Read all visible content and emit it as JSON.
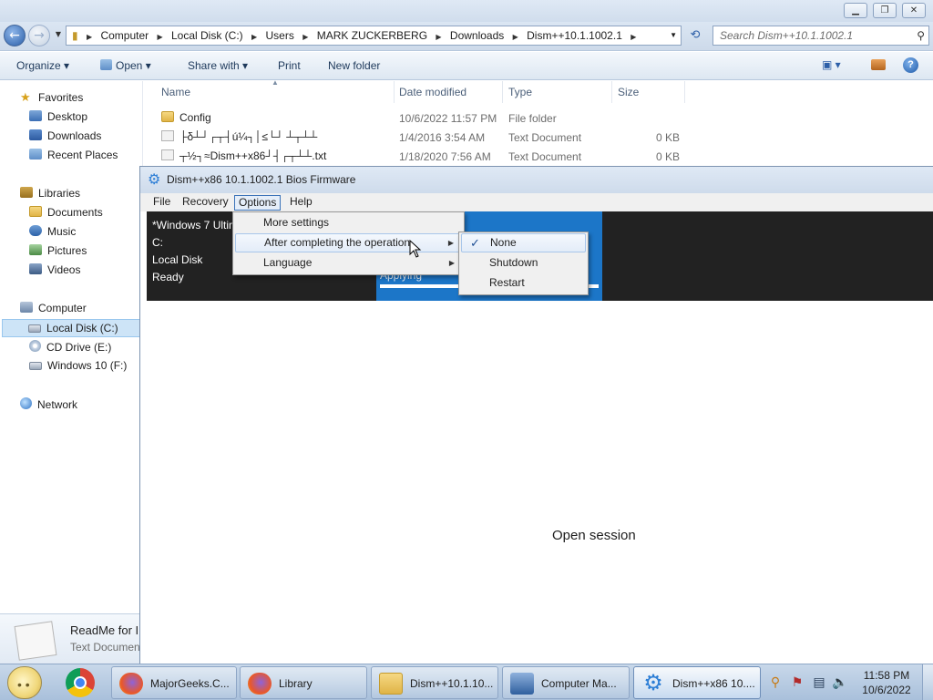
{
  "explorer": {
    "breadcrumbs": [
      "Computer",
      "Local Disk (C:)",
      "Users",
      "MARK ZUCKERBERG",
      "Downloads",
      "Dism++10.1.1002.1"
    ],
    "search_placeholder": "Search Dism++10.1.1002.1",
    "toolbar": {
      "organize": "Organize ▾",
      "open": "Open ▾",
      "share_with": "Share with ▾",
      "print": "Print",
      "new_folder": "New folder"
    },
    "nav": {
      "favorites": "Favorites",
      "desktop": "Desktop",
      "downloads": "Downloads",
      "recent_places": "Recent Places",
      "libraries": "Libraries",
      "documents": "Documents",
      "music": "Music",
      "pictures": "Pictures",
      "videos": "Videos",
      "computer": "Computer",
      "local_disk": "Local Disk (C:)",
      "cd_drive": "CD Drive (E:)",
      "windows10": "Windows 10 (F:)",
      "network": "Network"
    },
    "columns": {
      "name": "Name",
      "date": "Date modified",
      "type": "Type",
      "size": "Size"
    },
    "files": [
      {
        "name": "Config",
        "date": "10/6/2022 11:57 PM",
        "type": "File folder",
        "size": ""
      },
      {
        "name": "├δ┴┘┌┬┤ú¼┐│≤└┘ ┴┬┴┴",
        "date": "1/4/2016 3:54 AM",
        "type": "Text Document",
        "size": "0 KB"
      },
      {
        "name": "┬½┐≈Dism++x86┘┤┌┬┴┴.txt",
        "date": "1/18/2020 7:56 AM",
        "type": "Text Document",
        "size": "0 KB"
      }
    ],
    "details": {
      "name": "ReadMe for I",
      "type": "Text Documen"
    }
  },
  "dism": {
    "title": "Dism++x86 10.1.1002.1 Bios Firmware",
    "menu": {
      "file": "File",
      "recovery": "Recovery",
      "options": "Options",
      "help": "Help"
    },
    "session": {
      "os": "*Windows 7 Ultim",
      "drive": "C:",
      "disk": "Local Disk",
      "status": "Ready",
      "progress_label": "Applying",
      "progress_fraction": 1.0
    },
    "options_menu": {
      "more_settings": "More settings",
      "after_completing": "After completing the operation",
      "language": "Language"
    },
    "after_submenu": {
      "none": "None",
      "shutdown": "Shutdown",
      "restart": "Restart",
      "checked": "None"
    },
    "open_session": "Open session"
  },
  "taskbar": {
    "buttons": [
      {
        "label": "MajorGeeks.C...",
        "icon": "firefox-icon"
      },
      {
        "label": "Library",
        "icon": "firefox-icon"
      },
      {
        "label": "Dism++10.1.10...",
        "icon": "folder-icon"
      },
      {
        "label": "Computer Ma...",
        "icon": "computer-management-icon"
      },
      {
        "label": "Dism++x86 10....",
        "icon": "gear-icon"
      }
    ],
    "time": "11:58 PM",
    "date": "10/6/2022"
  },
  "colors": {
    "accent_blue": "#1c76c8",
    "session_bg": "#222222",
    "menu_bg": "#f0f0f0"
  }
}
